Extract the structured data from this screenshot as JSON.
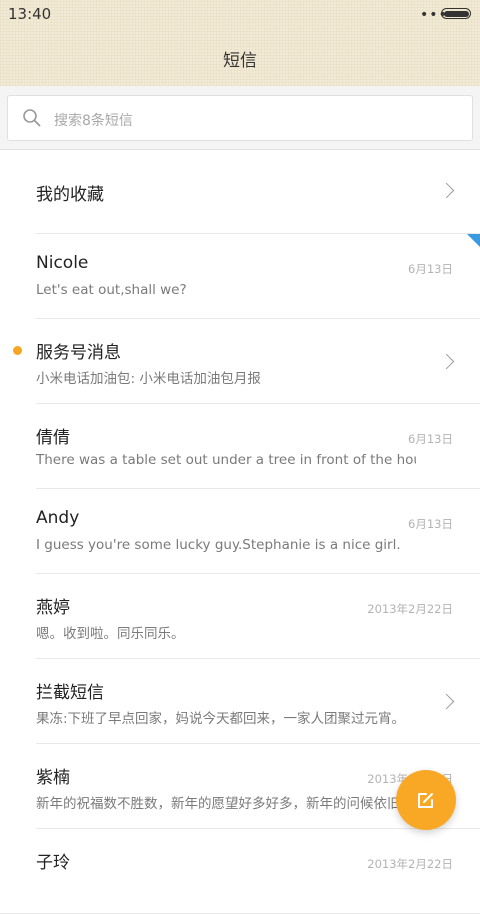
{
  "status_bar": {
    "time": "13:40",
    "dots": "•••"
  },
  "header": {
    "title": "短信"
  },
  "search": {
    "placeholder": "搜索8条短信"
  },
  "favorites": {
    "label": "我的收藏"
  },
  "conversations": [
    {
      "name": "Nicole",
      "preview": "Let's eat out,shall we?",
      "date": "6月13日"
    },
    {
      "name": "服务号消息",
      "preview": "小米电话加油包: 小米电话加油包月报",
      "date": ""
    },
    {
      "name": "倩倩",
      "preview": "There was a table set out under a tree in front of the hous",
      "date": "6月13日"
    },
    {
      "name": "Andy",
      "preview": "I guess you're some lucky guy.Stephanie is a nice girl.",
      "date": "6月13日"
    },
    {
      "name": "燕婷",
      "preview": "嗯。收到啦。同乐同乐。",
      "date": "2013年2月22日"
    },
    {
      "name": "拦截短信",
      "preview": "果冻:下班了早点回家，妈说今天都回来，一家人团聚过元宵。",
      "date": ""
    },
    {
      "name": "紫楠",
      "preview": "新年的祝福数不胜数，新年的愿望好多好多，新年的问候依旧",
      "date": "2013年2月22日"
    },
    {
      "name": "子玲",
      "preview": "",
      "date": "2013年2月22日"
    }
  ],
  "colors": {
    "accent": "#f9a825",
    "unread_dot": "#f5a623",
    "corner_marker": "#3a9ae0"
  }
}
